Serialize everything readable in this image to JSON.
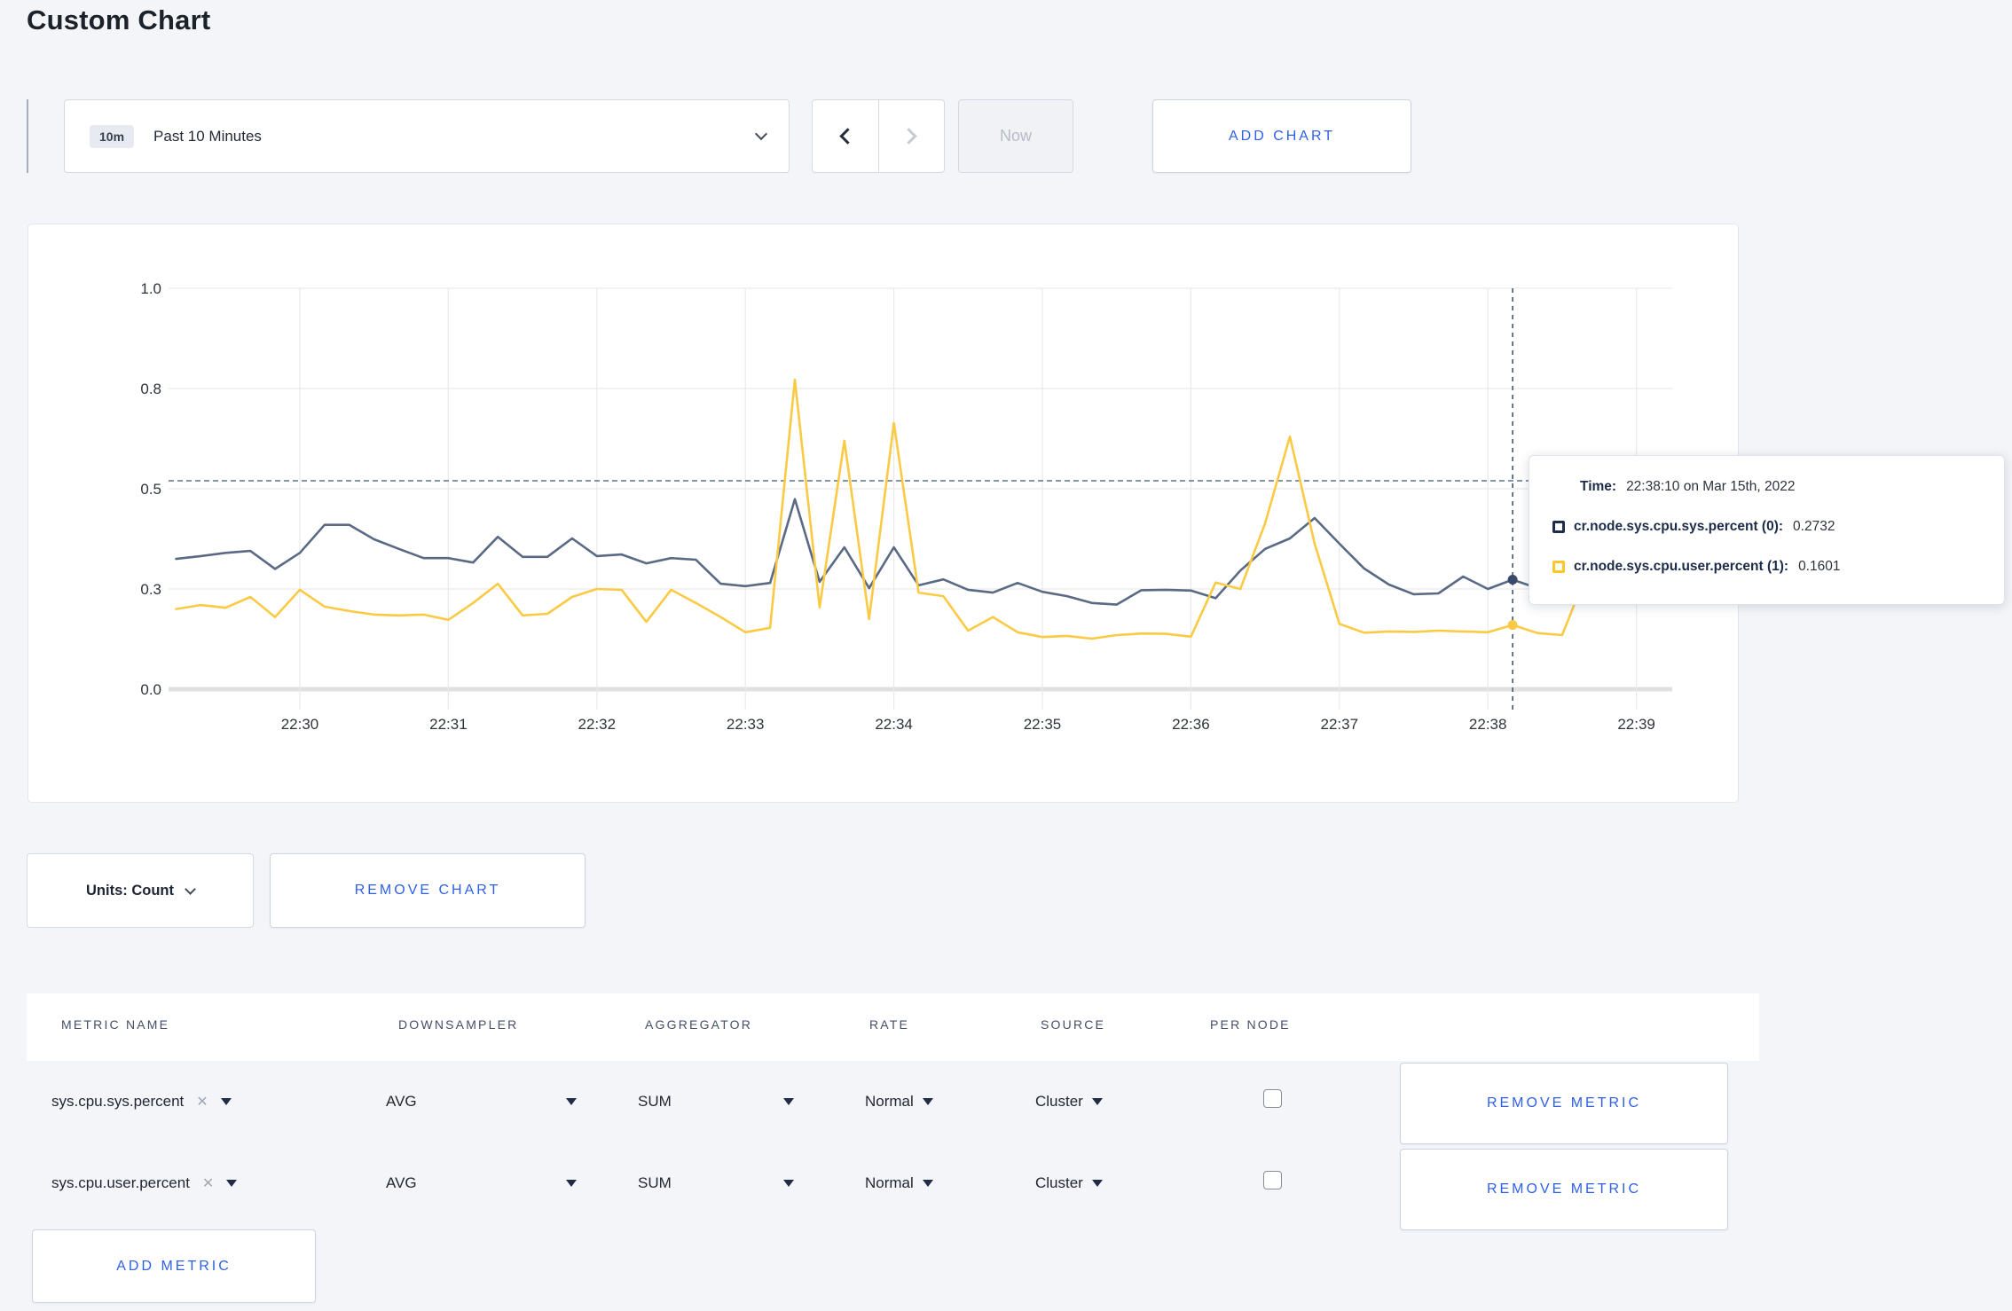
{
  "page": {
    "title": "Custom Chart"
  },
  "toolbar": {
    "range_badge": "10m",
    "range_label": "Past 10 Minutes",
    "prev_arrow": "chevron-left",
    "next_arrow": "chevron-right",
    "now_label": "Now",
    "add_chart_label": "ADD CHART"
  },
  "chart_data": {
    "type": "line",
    "title": "",
    "xlabel": "",
    "ylabel": "",
    "ylim": [
      0,
      1
    ],
    "grid": true,
    "x_axis": {
      "labels": [
        "22:30",
        "22:31",
        "22:32",
        "22:33",
        "22:34",
        "22:35",
        "22:36",
        "22:37",
        "22:38",
        "22:39"
      ]
    },
    "y_axis": {
      "ticks": [
        {
          "v": 0.0,
          "label": "0.0"
        },
        {
          "v": 0.25,
          "label": "0.3"
        },
        {
          "v": 0.5,
          "label": "0.5"
        },
        {
          "v": 0.75,
          "label": "0.8"
        },
        {
          "v": 1.0,
          "label": "1.0"
        }
      ]
    },
    "x_start": "22:29:10",
    "x_interval_sec": 10,
    "hover_line_value": 0.52,
    "crosshair": {
      "time": "22:38:10",
      "t_sec": 540,
      "sys_value": 0.2732,
      "user_value": 0.1601
    },
    "series": [
      {
        "name": "cr.node.sys.cpu.sys.percent",
        "color": "#5a6a84",
        "values": [
          0.325,
          0.332,
          0.34,
          0.345,
          0.3,
          0.34,
          0.41,
          0.41,
          0.374,
          0.35,
          0.327,
          0.327,
          0.316,
          0.38,
          0.33,
          0.33,
          0.376,
          0.332,
          0.336,
          0.314,
          0.327,
          0.323,
          0.263,
          0.257,
          0.265,
          0.474,
          0.268,
          0.354,
          0.252,
          0.354,
          0.259,
          0.274,
          0.248,
          0.241,
          0.265,
          0.243,
          0.232,
          0.215,
          0.211,
          0.247,
          0.248,
          0.246,
          0.227,
          0.296,
          0.35,
          0.376,
          0.427,
          0.363,
          0.301,
          0.261,
          0.237,
          0.239,
          0.281,
          0.25,
          0.2732,
          0.252,
          0.26,
          0.28,
          0.27,
          0.28,
          0.27
        ]
      },
      {
        "name": "cr.node.sys.cpu.user.percent",
        "color": "#fbca44",
        "values": [
          0.2,
          0.21,
          0.203,
          0.23,
          0.18,
          0.248,
          0.206,
          0.195,
          0.186,
          0.184,
          0.186,
          0.173,
          0.215,
          0.263,
          0.184,
          0.188,
          0.23,
          0.25,
          0.248,
          0.168,
          0.248,
          0.215,
          0.18,
          0.142,
          0.153,
          0.772,
          0.204,
          0.62,
          0.175,
          0.664,
          0.241,
          0.232,
          0.146,
          0.18,
          0.142,
          0.13,
          0.133,
          0.126,
          0.135,
          0.139,
          0.138,
          0.131,
          0.266,
          0.25,
          0.414,
          0.63,
          0.363,
          0.163,
          0.141,
          0.144,
          0.143,
          0.146,
          0.144,
          0.142,
          0.1601,
          0.14,
          0.135,
          0.29,
          0.3,
          0.29,
          0.22
        ]
      }
    ]
  },
  "tooltip": {
    "time_label": "Time:",
    "time_value": "22:38:10 on Mar 15th, 2022",
    "rows": [
      {
        "label": "cr.node.sys.cpu.sys.percent (0):",
        "value": "0.2732",
        "color": "#1f2c4d"
      },
      {
        "label": "cr.node.sys.cpu.user.percent (1):",
        "value": "0.1601",
        "color": "#ffc62b"
      }
    ]
  },
  "units_bar": {
    "units_label": "Units: Count",
    "remove_chart_label": "REMOVE CHART"
  },
  "metrics_table": {
    "headers": [
      "METRIC NAME",
      "DOWNSAMPLER",
      "AGGREGATOR",
      "RATE",
      "SOURCE",
      "PER NODE"
    ],
    "rows": [
      {
        "name": "sys.cpu.sys.percent",
        "downsampler": "AVG",
        "aggregator": "SUM",
        "rate": "Normal",
        "source": "Cluster",
        "per_node_checked": false,
        "remove_label": "REMOVE METRIC"
      },
      {
        "name": "sys.cpu.user.percent",
        "downsampler": "AVG",
        "aggregator": "SUM",
        "rate": "Normal",
        "source": "Cluster",
        "per_node_checked": false,
        "remove_label": "REMOVE METRIC"
      }
    ],
    "add_metric_label": "ADD METRIC"
  }
}
